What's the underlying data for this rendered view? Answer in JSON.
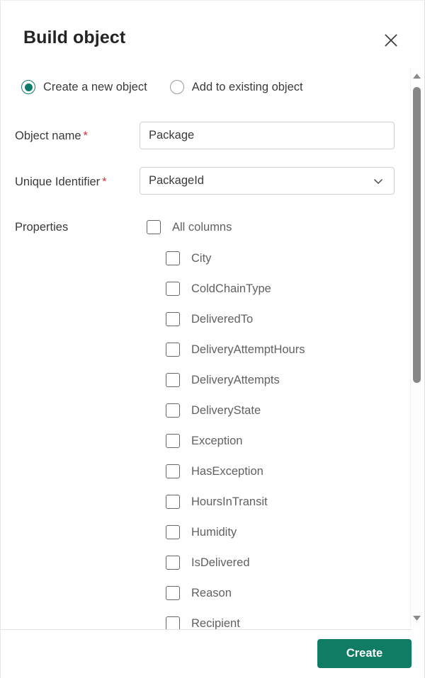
{
  "dialog": {
    "title": "Build object",
    "close_icon": "close-icon"
  },
  "mode": {
    "options": [
      {
        "label": "Create a new object",
        "selected": true
      },
      {
        "label": "Add to existing object",
        "selected": false
      }
    ]
  },
  "fields": {
    "object_name": {
      "label": "Object name",
      "required_marker": "*",
      "value": "Package",
      "placeholder": "Object name"
    },
    "unique_identifier": {
      "label": "Unique Identifier",
      "required_marker": "*",
      "value": "PackageId",
      "chevron_icon": "chevron-down-icon"
    }
  },
  "properties": {
    "label": "Properties",
    "all_columns": {
      "label": "All columns",
      "checked": false
    },
    "items": [
      {
        "label": "City",
        "checked": false
      },
      {
        "label": "ColdChainType",
        "checked": false
      },
      {
        "label": "DeliveredTo",
        "checked": false
      },
      {
        "label": "DeliveryAttemptHours",
        "checked": false
      },
      {
        "label": "DeliveryAttempts",
        "checked": false
      },
      {
        "label": "DeliveryState",
        "checked": false
      },
      {
        "label": "Exception",
        "checked": false
      },
      {
        "label": "HasException",
        "checked": false
      },
      {
        "label": "HoursInTransit",
        "checked": false
      },
      {
        "label": "Humidity",
        "checked": false
      },
      {
        "label": "IsDelivered",
        "checked": false
      },
      {
        "label": "Reason",
        "checked": false
      },
      {
        "label": "Recipient",
        "checked": false
      }
    ]
  },
  "scrollbar": {
    "up_icon": "scroll-up-arrow-icon",
    "down_icon": "scroll-down-arrow-icon"
  },
  "footer": {
    "create_label": "Create"
  },
  "colors": {
    "accent": "#107c63",
    "radio_selected": "#0f7b6c",
    "required": "#d13438",
    "text": "#3a3a3a",
    "list_text": "#616161"
  }
}
